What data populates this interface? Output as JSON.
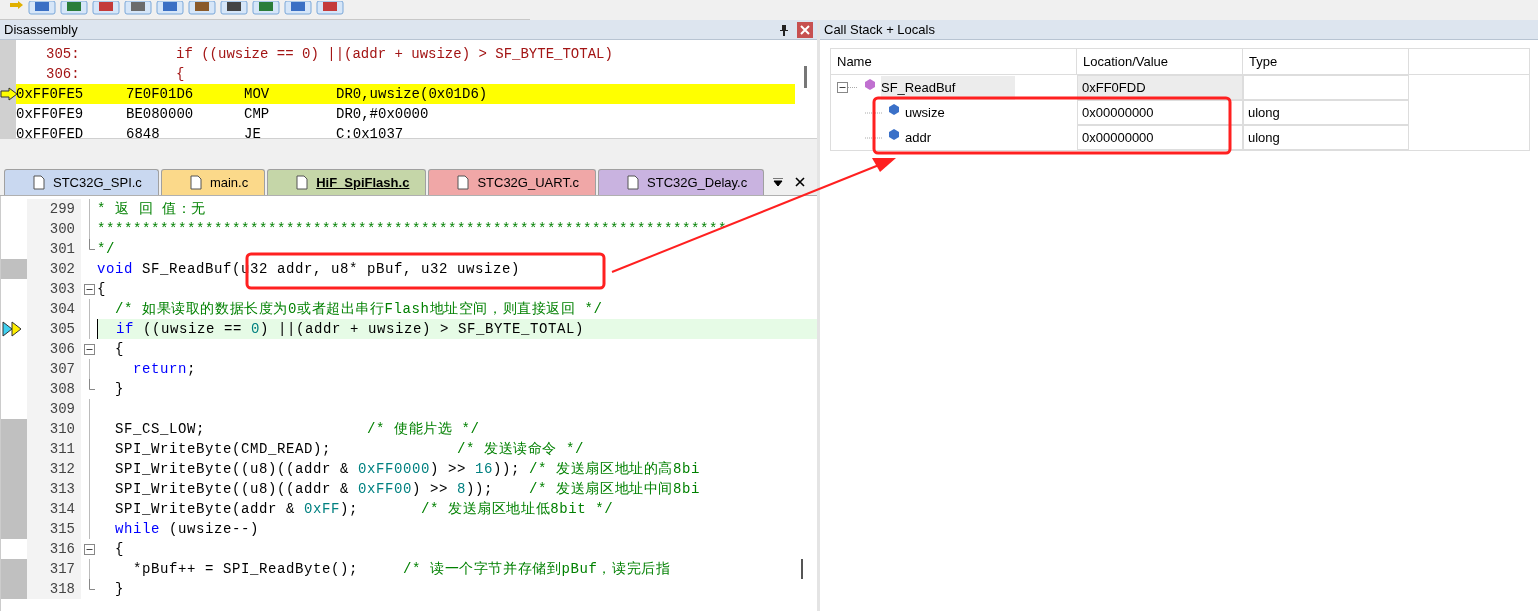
{
  "disassembly": {
    "title": "Disassembly",
    "rows": [
      {
        "kind": "source",
        "line": "305:",
        "code": "if ((uwsize == 0) ||(addr + uwsize) > SF_BYTE_TOTAL)"
      },
      {
        "kind": "source",
        "line": "306:",
        "code": "{"
      },
      {
        "kind": "asm",
        "address": "0xFF0FE5",
        "opcode": "7E0F01D6",
        "mnemonic": "MOV",
        "operands": "DR0,uwsize(0x01D6)",
        "current": true
      },
      {
        "kind": "asm",
        "address": "0xFF0FE9",
        "opcode": "BE080000",
        "mnemonic": "CMP",
        "operands": "DR0,#0x0000",
        "current": false
      },
      {
        "kind": "asm",
        "address": "0xFF0FED",
        "opcode": "6848",
        "mnemonic": "JE",
        "operands": "C:0x1037",
        "current": false
      }
    ]
  },
  "tabs": [
    {
      "label": "STC32G_SPI.c",
      "selected": false,
      "color": "#c9d8f0"
    },
    {
      "label": "main.c",
      "selected": false,
      "color": "#fbd98a"
    },
    {
      "label": "HiF_SpiFlash.c",
      "selected": true,
      "color": "#c5d6a8"
    },
    {
      "label": "STC32G_UART.c",
      "selected": false,
      "color": "#f0a7a7"
    },
    {
      "label": "STC32G_Delay.c",
      "selected": false,
      "color": "#c9b3e0"
    }
  ],
  "editor": {
    "lines": [
      {
        "number": "299",
        "marked": false,
        "current": false,
        "kind": "inside",
        "segments": [
          {
            "kind": "comment",
            "text": "* 返 回 值：无"
          }
        ]
      },
      {
        "number": "300",
        "marked": false,
        "current": false,
        "kind": "inside",
        "segments": [
          {
            "kind": "comment",
            "text": "**********************************************************************"
          }
        ]
      },
      {
        "number": "301",
        "marked": false,
        "current": false,
        "kind": "close",
        "segments": [
          {
            "kind": "comment",
            "text": "*/"
          }
        ]
      },
      {
        "number": "302",
        "marked": true,
        "current": false,
        "kind": "plain",
        "segments": [
          {
            "kind": "keyword",
            "text": "void"
          },
          {
            "kind": "plain",
            "text": " SF_ReadBuf(u32 addr, u8* pBuf, u32 uwsize)"
          }
        ]
      },
      {
        "number": "303",
        "marked": false,
        "current": false,
        "kind": "open",
        "segments": [
          {
            "kind": "plain",
            "text": "{"
          }
        ]
      },
      {
        "number": "304",
        "marked": false,
        "current": false,
        "kind": "inside",
        "segments": [
          {
            "kind": "comment",
            "text": "  /* 如果读取的数据长度为0或者超出串行Flash地址空间，则直接返回 */"
          }
        ]
      },
      {
        "number": "305",
        "marked": false,
        "current": true,
        "kind": "inside",
        "segments": [
          {
            "kind": "keyword",
            "text": "  if"
          },
          {
            "kind": "plain",
            "text": " ((uwsize == "
          },
          {
            "kind": "number",
            "text": "0"
          },
          {
            "kind": "plain",
            "text": ") ||(addr + uwsize) > SF_BYTE_TOTAL)"
          }
        ]
      },
      {
        "number": "306",
        "marked": false,
        "current": false,
        "kind": "open",
        "segments": [
          {
            "kind": "plain",
            "text": "  {"
          }
        ]
      },
      {
        "number": "307",
        "marked": false,
        "current": false,
        "kind": "inside",
        "segments": [
          {
            "kind": "keyword",
            "text": "    return"
          },
          {
            "kind": "plain",
            "text": ";"
          }
        ]
      },
      {
        "number": "308",
        "marked": false,
        "current": false,
        "kind": "close",
        "segments": [
          {
            "kind": "plain",
            "text": "  }"
          }
        ]
      },
      {
        "number": "309",
        "marked": false,
        "current": false,
        "kind": "inside"
      },
      {
        "number": "310",
        "marked": true,
        "current": false,
        "kind": "inside",
        "segments": [
          {
            "kind": "plain",
            "text": "  SF_CS_LOW;                  "
          },
          {
            "kind": "comment",
            "text": "/* 使能片选 */"
          }
        ]
      },
      {
        "number": "311",
        "marked": true,
        "current": false,
        "kind": "inside",
        "segments": [
          {
            "kind": "plain",
            "text": "  SPI_WriteByte(CMD_READ);              "
          },
          {
            "kind": "comment",
            "text": "/* 发送读命令 */"
          }
        ]
      },
      {
        "number": "312",
        "marked": true,
        "current": false,
        "kind": "inside",
        "segments": [
          {
            "kind": "plain",
            "text": "  SPI_WriteByte((u8)((addr & "
          },
          {
            "kind": "number",
            "text": "0xFF0000"
          },
          {
            "kind": "plain",
            "text": ") >> "
          },
          {
            "kind": "number",
            "text": "16"
          },
          {
            "kind": "plain",
            "text": ")); "
          },
          {
            "kind": "comment",
            "text": "/* 发送扇区地址的高8bi"
          }
        ]
      },
      {
        "number": "313",
        "marked": true,
        "current": false,
        "kind": "inside",
        "segments": [
          {
            "kind": "plain",
            "text": "  SPI_WriteByte((u8)((addr & "
          },
          {
            "kind": "number",
            "text": "0xFF00"
          },
          {
            "kind": "plain",
            "text": ") >> "
          },
          {
            "kind": "number",
            "text": "8"
          },
          {
            "kind": "plain",
            "text": "));    "
          },
          {
            "kind": "comment",
            "text": "/* 发送扇区地址中间8bi"
          }
        ]
      },
      {
        "number": "314",
        "marked": true,
        "current": false,
        "kind": "inside",
        "segments": [
          {
            "kind": "plain",
            "text": "  SPI_WriteByte(addr & "
          },
          {
            "kind": "number",
            "text": "0xFF"
          },
          {
            "kind": "plain",
            "text": ");       "
          },
          {
            "kind": "comment",
            "text": "/* 发送扇区地址低8bit */"
          }
        ]
      },
      {
        "number": "315",
        "marked": true,
        "current": false,
        "kind": "inside",
        "segments": [
          {
            "kind": "keyword",
            "text": "  while"
          },
          {
            "kind": "plain",
            "text": " (uwsize--)"
          }
        ]
      },
      {
        "number": "316",
        "marked": false,
        "current": false,
        "kind": "open",
        "segments": [
          {
            "kind": "plain",
            "text": "  {"
          }
        ]
      },
      {
        "number": "317",
        "marked": true,
        "current": false,
        "kind": "inside",
        "segments": [
          {
            "kind": "plain",
            "text": "    *pBuf++ = SPI_ReadByte();     "
          },
          {
            "kind": "comment",
            "text": "/* 读一个字节并存储到pBuf，读完后指"
          }
        ]
      },
      {
        "number": "318",
        "marked": true,
        "current": false,
        "kind": "close",
        "segments": [
          {
            "kind": "plain",
            "text": "  }"
          }
        ]
      }
    ]
  },
  "locals": {
    "title": "Call Stack + Locals",
    "columns": [
      "Name",
      "Location/Value",
      "Type"
    ],
    "rows": [
      {
        "name": "SF_ReadBuf",
        "value": "0xFF0FDD",
        "expanded": true,
        "children": [
          {
            "name": "uwsize",
            "value": "0x00000000",
            "type": "ulong"
          },
          {
            "name": "addr",
            "value": "0x00000000",
            "type": "ulong"
          }
        ]
      }
    ]
  }
}
